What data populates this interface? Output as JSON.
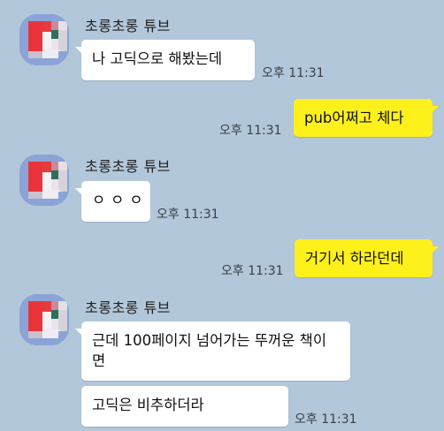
{
  "chat": {
    "sender_name": "초롱초롱 튜브",
    "messages": [
      {
        "text": "나 고딕으로 해봤는데",
        "time": "오후 11:31"
      },
      {
        "text": "pub어쩌고 체다",
        "time": "오후 11:31"
      },
      {
        "text": "ㅇㅇㅇ",
        "time": "오후 11:31"
      },
      {
        "text": "거기서 하라던데",
        "time": "오후 11:31"
      },
      {
        "text": "근데 100페이지 넘어가는 뚜꺼운 책이면"
      },
      {
        "text": "고딕은 비추하더라",
        "time": "오후 11:31"
      }
    ]
  },
  "colors": {
    "background": "#b2c7d9",
    "outgoing_bubble": "#fef01b",
    "incoming_bubble": "#ffffff"
  }
}
